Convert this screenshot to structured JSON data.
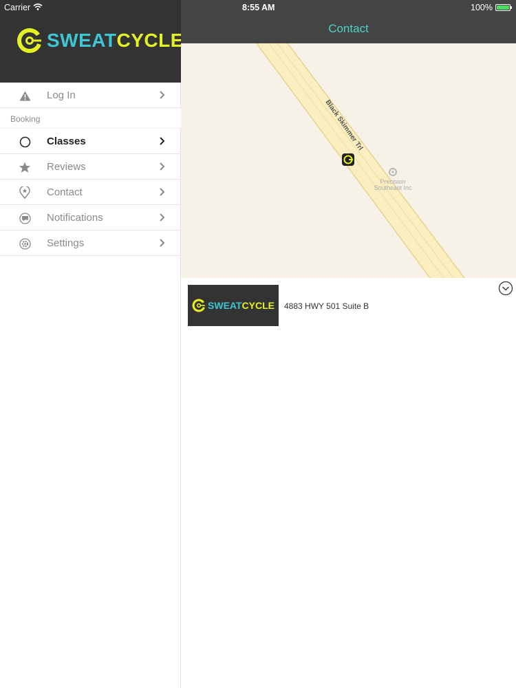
{
  "status_bar": {
    "carrier": "Carrier",
    "time": "8:55 AM",
    "battery": "100%"
  },
  "brand": {
    "name_part1": "SWEAT",
    "name_part2": "CYCLE"
  },
  "sidebar": {
    "login_label": "Log In",
    "section_booking": "Booking",
    "items": [
      {
        "label": "Classes",
        "icon": "circle-icon",
        "active": true
      },
      {
        "label": "Reviews",
        "icon": "star-icon",
        "active": false
      },
      {
        "label": "Contact",
        "icon": "map-pin-icon",
        "active": false
      },
      {
        "label": "Notifications",
        "icon": "chat-bubble-icon",
        "active": false
      },
      {
        "label": "Settings",
        "icon": "gear-icon",
        "active": false
      }
    ]
  },
  "header": {
    "title": "Contact"
  },
  "map": {
    "street_label": "Black Skimmer Trl",
    "poi_line1": "Precision",
    "poi_line2": "Southeast Inc"
  },
  "details": {
    "address": "4883 HWY 501 Suite B"
  },
  "colors": {
    "brand_cyan": "#3ec6d4",
    "brand_yellow": "#e4f123",
    "nav_title": "#4dd4c6",
    "header_bg": "#333333"
  }
}
